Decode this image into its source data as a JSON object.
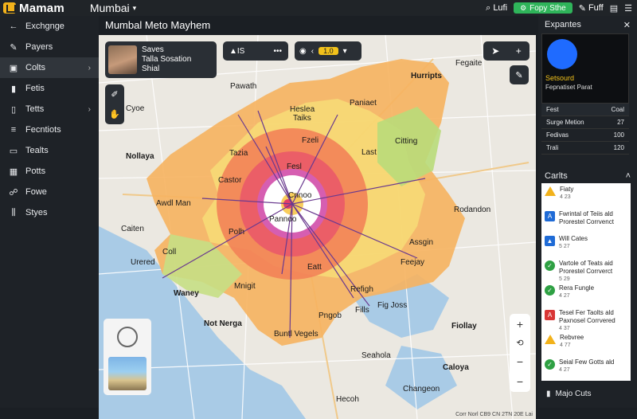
{
  "app": {
    "name": "Mamam",
    "city": "Mumbai"
  },
  "top": {
    "search_label": "Lufi",
    "cta_label": "Fopy Sthe",
    "edit_label": "Fuff"
  },
  "sidebar": {
    "items": [
      {
        "label": "Exchgnge",
        "icon": "arrow-left-icon"
      },
      {
        "label": "Payers",
        "icon": "pencil-icon"
      },
      {
        "label": "Colts",
        "icon": "layers-icon"
      },
      {
        "label": "Fetis",
        "icon": "file-icon"
      },
      {
        "label": "Tetts",
        "icon": "trash-icon"
      },
      {
        "label": "Fecntiots",
        "icon": "list-icon"
      },
      {
        "label": "Tealts",
        "icon": "box-icon"
      },
      {
        "label": "Potts",
        "icon": "grid-icon"
      },
      {
        "label": "Fowe",
        "icon": "users-icon"
      },
      {
        "label": "Styes",
        "icon": "chart-icon"
      }
    ]
  },
  "map": {
    "title": "Mumbal Meto Mayhem",
    "profile": {
      "line1": "Saves",
      "line2": "Talla Sosation",
      "line3": "Shial"
    },
    "ctrl_count": "IS",
    "ctrl_pill": "1.0",
    "attribution": "Corr Norl  CB9  CN 2TN 20E Lai",
    "labels": [
      "Hurripts",
      "Nollaya",
      "Pawath",
      "Heslea",
      "Taiks",
      "Fesl",
      "Paniaet",
      "Tazia",
      "Fzeli",
      "Last",
      "Citting",
      "Castor",
      "Cnnoo",
      "Pannoo",
      "Awdl Man",
      "Rodandon",
      "Caiten",
      "Polh",
      "Assgin",
      "Coll",
      "Urered",
      "Feejay",
      "Waney",
      "Mnigit",
      "Eatt",
      "Refigh",
      "Not Nerga",
      "Pngob",
      "Fills",
      "Fig Joss",
      "Fiollay",
      "Buntl Vegels",
      "Cyoe",
      "Seahola",
      "Caloya",
      "Changeon",
      "Hecoh",
      "Fegaite"
    ]
  },
  "right": {
    "expansions_title": "Expantes",
    "exp_title": "Setsourd",
    "exp_sub": "Fepnatiset Parat",
    "exp_rows": [
      {
        "k": "Fest",
        "v": "Coal"
      },
      {
        "k": "Surge Metion",
        "v": "27"
      },
      {
        "k": "Fedivas",
        "v": "100"
      },
      {
        "k": "Trali",
        "v": "120"
      }
    ],
    "cards_title": "Carlts",
    "cards": [
      {
        "icon": "warning",
        "title": "Fiaty",
        "meta": "4 23"
      },
      {
        "icon": "blue",
        "title": "Fwrintal of Teiis ald Prorestel Corrvenct",
        "meta": ""
      },
      {
        "icon": "blue",
        "title": "Will Cates",
        "meta": "5 27"
      },
      {
        "icon": "green",
        "title": "Vartole of Teats aid Prorestel Corrverct",
        "meta": "5 29"
      },
      {
        "icon": "green",
        "title": "Rera Fungle",
        "meta": "4 27"
      },
      {
        "icon": "red",
        "title": "Tesel Fer Taolts ald Paxnosel Corrvered",
        "meta": "4 37"
      },
      {
        "icon": "warning",
        "title": "Rebvree",
        "meta": "4 77"
      },
      {
        "icon": "green",
        "title": "Seial Few Gotts ald",
        "meta": "4 27"
      }
    ],
    "footer_label": "Majo Cuts"
  }
}
